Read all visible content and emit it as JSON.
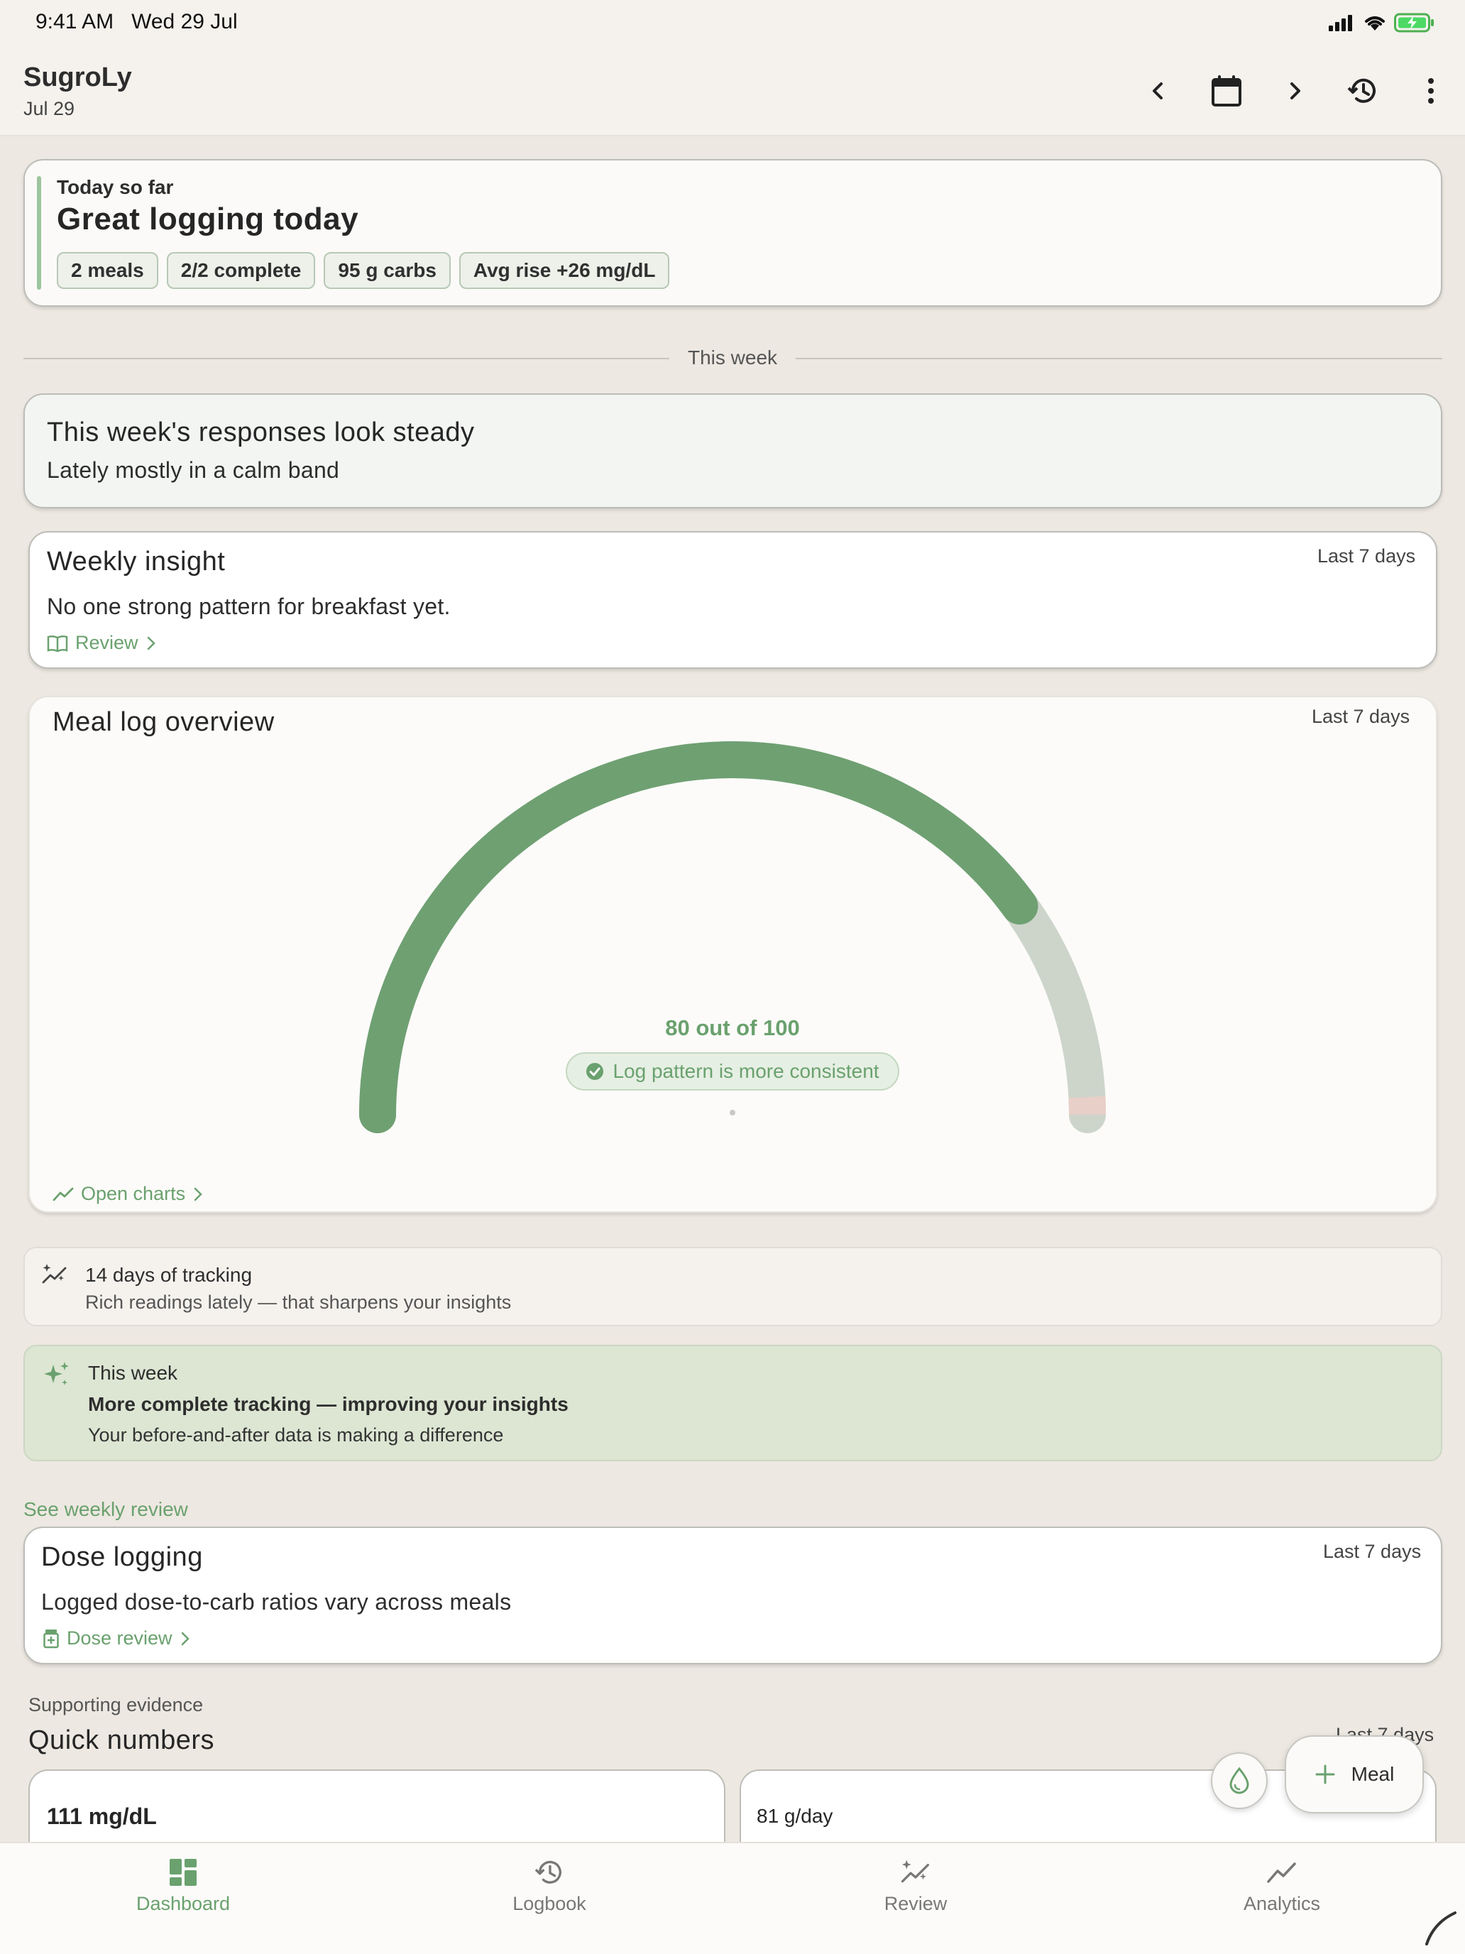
{
  "status_bar": {
    "time": "9:41 AM",
    "date": "Wed 29 Jul"
  },
  "header": {
    "title": "SugroLy",
    "date": "Jul 29"
  },
  "today": {
    "label": "Today so far",
    "title": "Great logging today",
    "chips": [
      "2 meals",
      "2/2 complete",
      "95 g carbs",
      "Avg rise +26 mg/dL"
    ]
  },
  "divider_label": "This week",
  "steady": {
    "title": "This week's responses look steady",
    "subtitle": "Lately mostly in a calm band"
  },
  "weekly_insight": {
    "title": "Weekly insight",
    "range": "Last 7 days",
    "body": "No one strong pattern for breakfast yet.",
    "link": "Review"
  },
  "overview": {
    "title": "Meal log overview",
    "range": "Last 7 days",
    "score_text": "80 out of 100",
    "score": 80,
    "score_max": 100,
    "pill": "Log pattern is more consistent",
    "link": "Open charts",
    "colors": {
      "fill": "#6fa072",
      "track": "#cdd5cb",
      "end_cap": "#e8cfc8"
    }
  },
  "tracking": {
    "title": "14 days of tracking",
    "subtitle": "Rich readings lately — that sharpens your insights"
  },
  "week_note": {
    "label": "This week",
    "title": "More complete tracking — improving your insights",
    "subtitle": "Your before-and-after data is making a difference"
  },
  "see_weekly_review": "See weekly review",
  "dose": {
    "title": "Dose logging",
    "range": "Last 7 days",
    "body": "Logged dose-to-carb ratios vary across meals",
    "link": "Dose review"
  },
  "quick": {
    "eyebrow": "Supporting evidence",
    "title": "Quick numbers",
    "range": "Last 7 days",
    "cards": [
      {
        "value": "111 mg/dL"
      },
      {
        "value": "81 g/day"
      }
    ]
  },
  "fab": {
    "meal_label": "Meal"
  },
  "nav": [
    {
      "label": "Dashboard",
      "icon": "dashboard-icon",
      "active": true
    },
    {
      "label": "Logbook",
      "icon": "history-icon",
      "active": false
    },
    {
      "label": "Review",
      "icon": "sparkle-trend-icon",
      "active": false
    },
    {
      "label": "Analytics",
      "icon": "trend-icon",
      "active": false
    }
  ],
  "accent_color": "#6aa16e"
}
